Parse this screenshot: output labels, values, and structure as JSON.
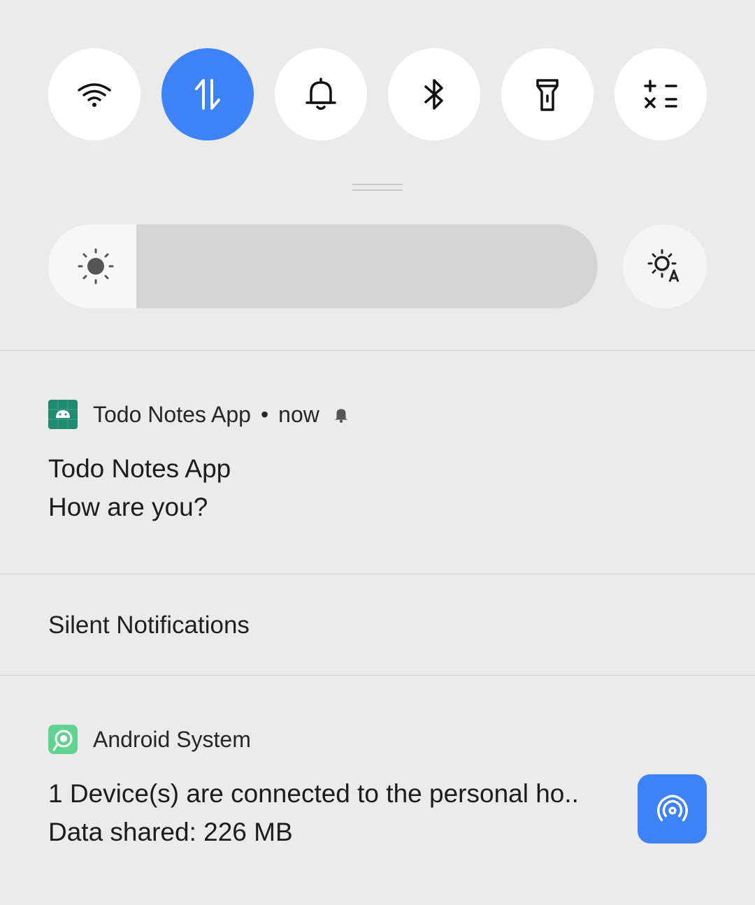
{
  "quick_settings": {
    "toggles": [
      {
        "name": "wifi",
        "icon": "wifi-icon",
        "active": false
      },
      {
        "name": "mobile-data",
        "icon": "mobile-data-icon",
        "active": true
      },
      {
        "name": "sound",
        "icon": "bell-icon",
        "active": false
      },
      {
        "name": "bluetooth",
        "icon": "bluetooth-icon",
        "active": false
      },
      {
        "name": "flashlight",
        "icon": "flashlight-icon",
        "active": false
      },
      {
        "name": "calculator",
        "icon": "calculator-icon",
        "active": false
      }
    ],
    "accent_color": "#3d82f7",
    "brightness_level": 0.16
  },
  "notifications": [
    {
      "app_name": "Todo Notes App",
      "time": "now",
      "separator": "•",
      "title": "Todo Notes App",
      "text": "How are you?",
      "icon": "android-app-icon"
    }
  ],
  "silent_section": {
    "label": "Silent Notifications"
  },
  "silent_notifications": [
    {
      "app_name": "Android System",
      "icon": "android-system-icon",
      "title": "1 Device(s) are connected to the personal ho..",
      "text": "Data shared: 226 MB",
      "action_icon": "hotspot-icon"
    }
  ]
}
